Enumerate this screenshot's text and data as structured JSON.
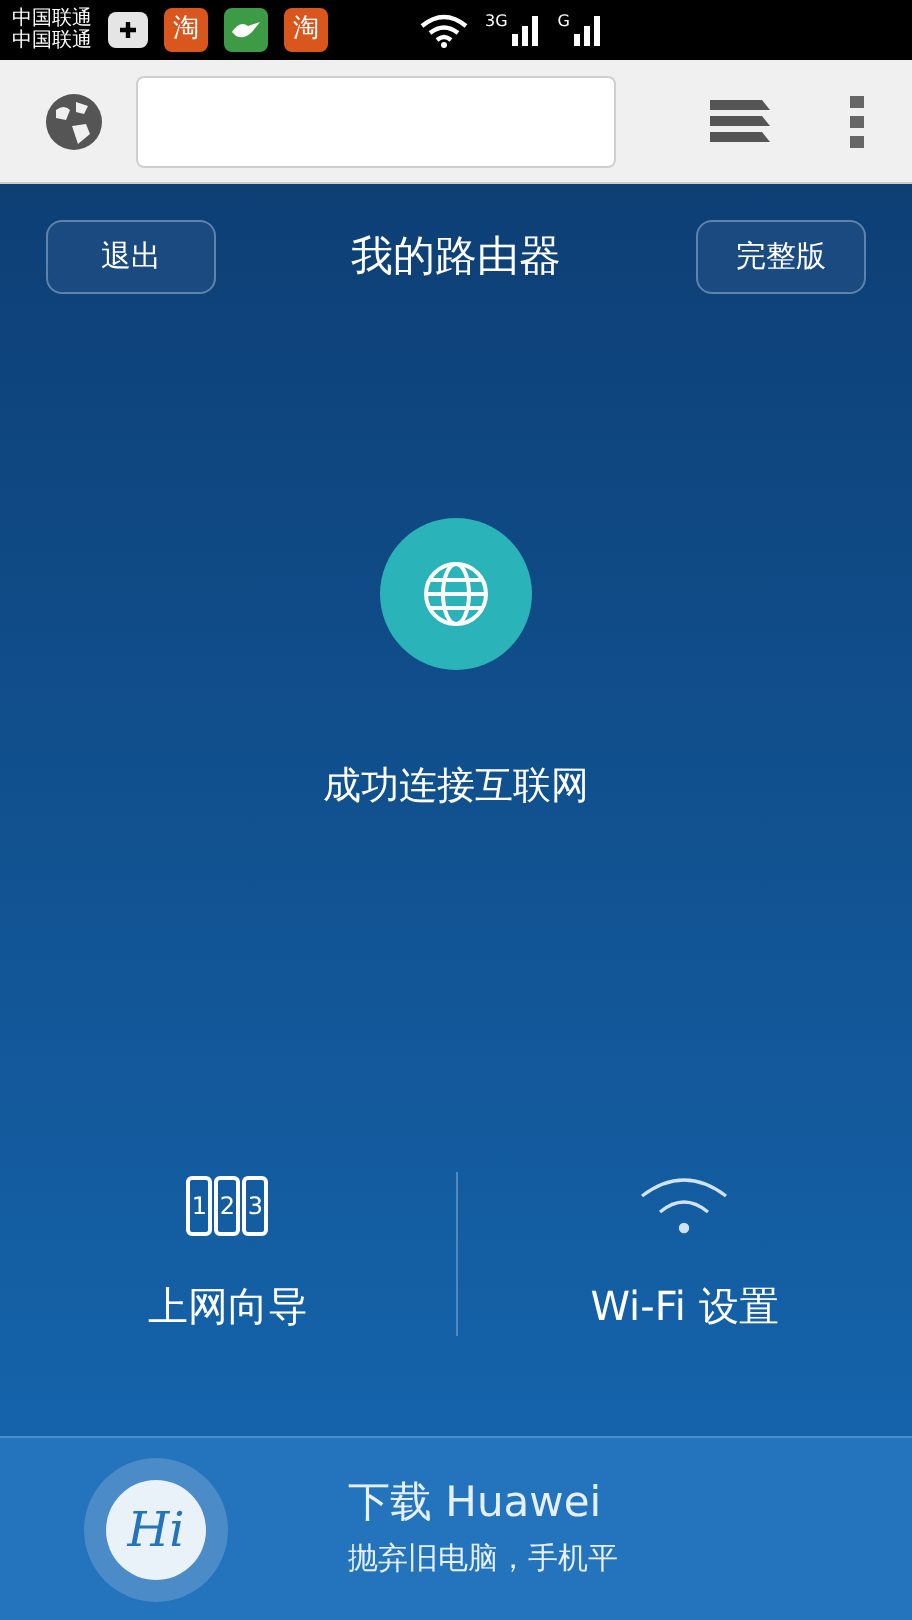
{
  "status_bar": {
    "carriers": [
      "中国联通",
      "中国联通"
    ],
    "notifications": [
      {
        "kind": "plus"
      },
      {
        "kind": "text",
        "text": "淘",
        "color": "#d9561c"
      },
      {
        "kind": "bird",
        "color": "#3d9b45"
      },
      {
        "kind": "text",
        "text": "淘",
        "color": "#d9561c"
      }
    ],
    "signals": [
      {
        "label": "3G"
      },
      {
        "label": "G"
      }
    ]
  },
  "header": {
    "left_button": "退出",
    "title": "我的路由器",
    "right_button": "完整版"
  },
  "connection": {
    "connected": true,
    "text": "成功连接互联网"
  },
  "shortcuts": [
    {
      "kind": "wizard",
      "label": "上网向导",
      "digits": [
        "1",
        "2",
        "3"
      ]
    },
    {
      "kind": "wifi",
      "label": "Wi-Fi 设置"
    }
  ],
  "banner": {
    "logo": "Hi",
    "title": "下载 Huawei",
    "subtitle": "抛弃旧电脑，手机平"
  }
}
